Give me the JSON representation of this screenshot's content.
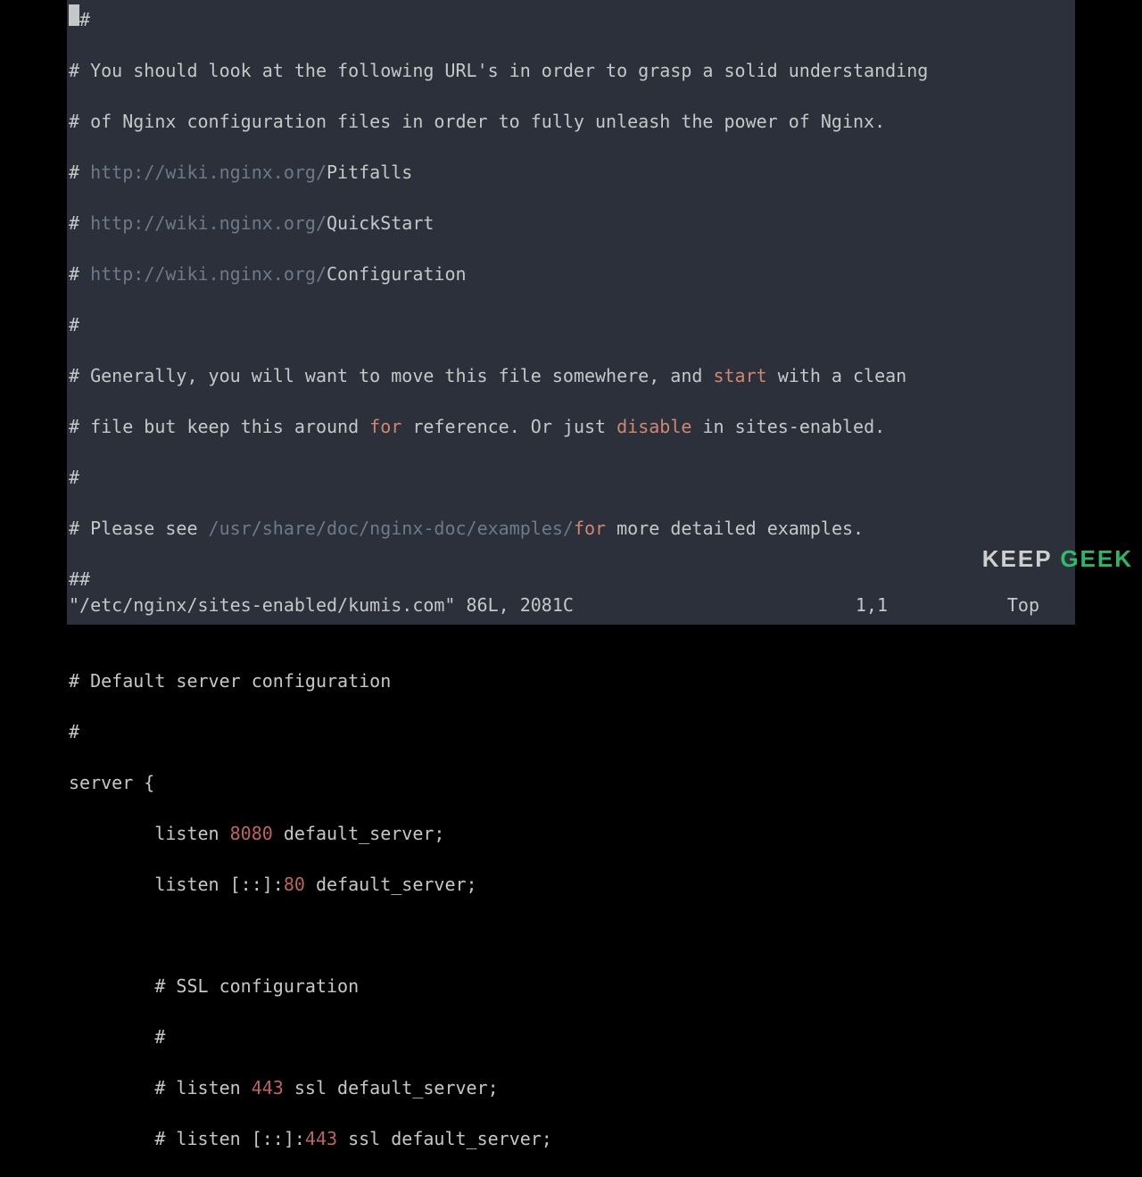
{
  "lines": {
    "l0a": "#",
    "l0b": "#",
    "c1": "# You should look at the following URL",
    "c1b": "'s in order to grasp a solid understanding",
    "c2": "# of Nginx configuration files in order to fully unleash the power of Nginx.",
    "c3hash": "# ",
    "c3u": "http:",
    "c3p": "//wiki.nginx.org/",
    "c3t": "Pitfalls",
    "c4hash": "# ",
    "c4u": "http:",
    "c4p": "//wiki.nginx.org/",
    "c4t": "QuickStart",
    "c5hash": "# ",
    "c5u": "http:",
    "c5p": "//wiki.nginx.org/",
    "c5t": "Configuration",
    "c6": "#",
    "c7a": "# Generally, you will want to move this file somewhere, and ",
    "c7k": "start",
    "c7b": " with a clean",
    "c8a": "# file but keep this around ",
    "c8k": "for",
    "c8b": " reference. Or just ",
    "c8k2": "disable",
    "c8c": " in sites-enabled.",
    "c9": "#",
    "c10a": "# Please see ",
    "c10p": "/usr/share/doc/nginx-doc/examples/",
    "c10b": " ",
    "c10k": "for",
    "c10c": " more detailed examples.",
    "c11": "##",
    "blank": " ",
    "c12": "# Default server configuration",
    "c13": "#",
    "s1": "server {",
    "s2a": "        listen ",
    "s2n": "8080",
    "s2b": " default_server;",
    "s3a": "        listen [::]:",
    "s3n": "80",
    "s3b": " default_server;",
    "s4": "        # SSL configuration",
    "s5": "        #",
    "s6a": "        # listen ",
    "s6n": "443",
    "s6b": " ssl default_server;",
    "s7a": "        # listen [::]:",
    "s7n": "443",
    "s7b": " ssl default_server;"
  },
  "status": {
    "file": "\"/etc/nginx/sites-enabled/kumis.com\" 86L, 2081C",
    "pos": "1,1",
    "top": "Top"
  },
  "watermark": {
    "a": "KEEP ",
    "b": "GEEK"
  }
}
